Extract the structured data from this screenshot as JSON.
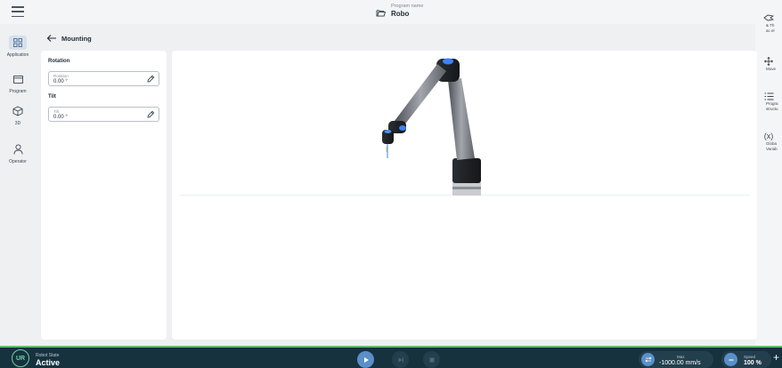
{
  "header": {
    "program_label": "Program name",
    "program_name": "Robo"
  },
  "left_nav": [
    {
      "label": "Application",
      "icon": "grid-icon",
      "active": true
    },
    {
      "label": "Program",
      "icon": "window-icon"
    },
    {
      "label": "3D",
      "icon": "cube-icon"
    },
    {
      "label": "Operator",
      "icon": "person-icon"
    }
  ],
  "right_rail": [
    {
      "label_lines": [
        "& Th",
        "ac el"
      ],
      "icon": "handheld-icon"
    },
    {
      "label_lines": [
        "Move"
      ],
      "icon": "move-arrows-icon"
    },
    {
      "label_lines": [
        "Progra",
        "structu"
      ],
      "icon": "list-icon"
    },
    {
      "label_lines": [
        "Globa",
        "Variab"
      ],
      "icon": "variable-icon",
      "glyph": "(x)"
    }
  ],
  "page": {
    "title": "Mounting"
  },
  "mounting": {
    "rotation_title": "Rotation",
    "rotation_field_label": "Rotation",
    "rotation_value": "0.00 °",
    "tilt_title": "Tilt",
    "tilt_field_label": "Tilt",
    "tilt_value": "0.00 °"
  },
  "status": {
    "robot_state_label": "Robot State",
    "robot_state": "Active",
    "max_label": "Max",
    "max_value": "-1000.00 mm/s",
    "speed_label": "Speed",
    "speed_value": "100 %"
  },
  "colors": {
    "accent": "#5a8fc9",
    "bottom_bar": "#17323f",
    "status_green": "#5fc06d",
    "robot_joint_blue": "#3b82f6"
  }
}
